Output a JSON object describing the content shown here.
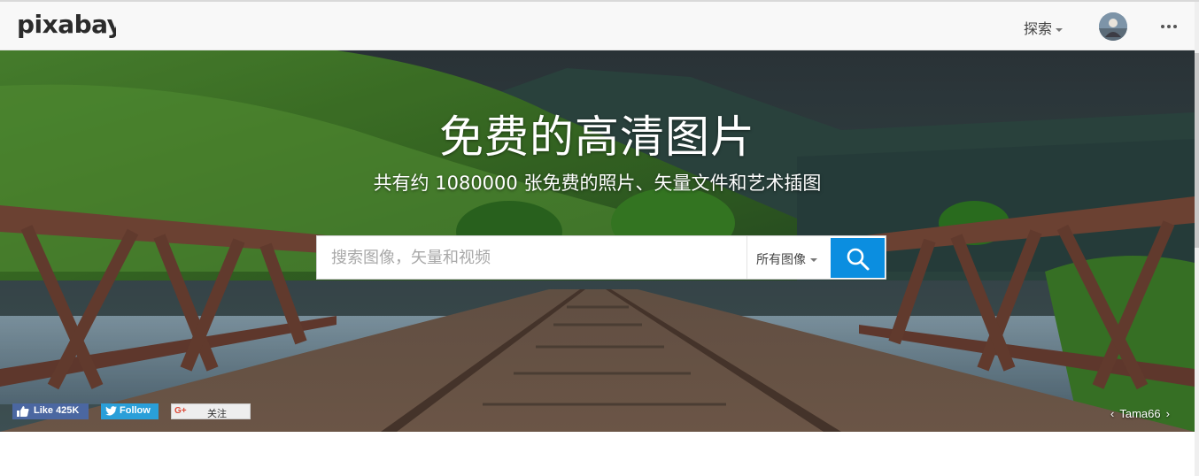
{
  "header": {
    "logo_text": "pixabay",
    "explore_label": "探索",
    "more_icon": "more-horizontal-icon",
    "avatar_icon": "user-avatar"
  },
  "hero": {
    "title": "免费的高清图片",
    "subtitle": "共有约 1080000 张免费的照片、矢量文件和艺术插图",
    "search": {
      "placeholder": "搜索图像，矢量和视频",
      "value": "",
      "type_label": "所有图像",
      "button_icon": "search-icon"
    },
    "social": {
      "facebook_label": "Like 425K",
      "twitter_label": "Follow",
      "gplus_label": "关注"
    },
    "credit": {
      "prev": "‹",
      "author": "Tama66",
      "next": "›"
    }
  },
  "colors": {
    "accent": "#0b8ee0",
    "header_bg": "#f8f8f8",
    "facebook": "#4b67a1",
    "twitter": "#2a9fd9"
  }
}
